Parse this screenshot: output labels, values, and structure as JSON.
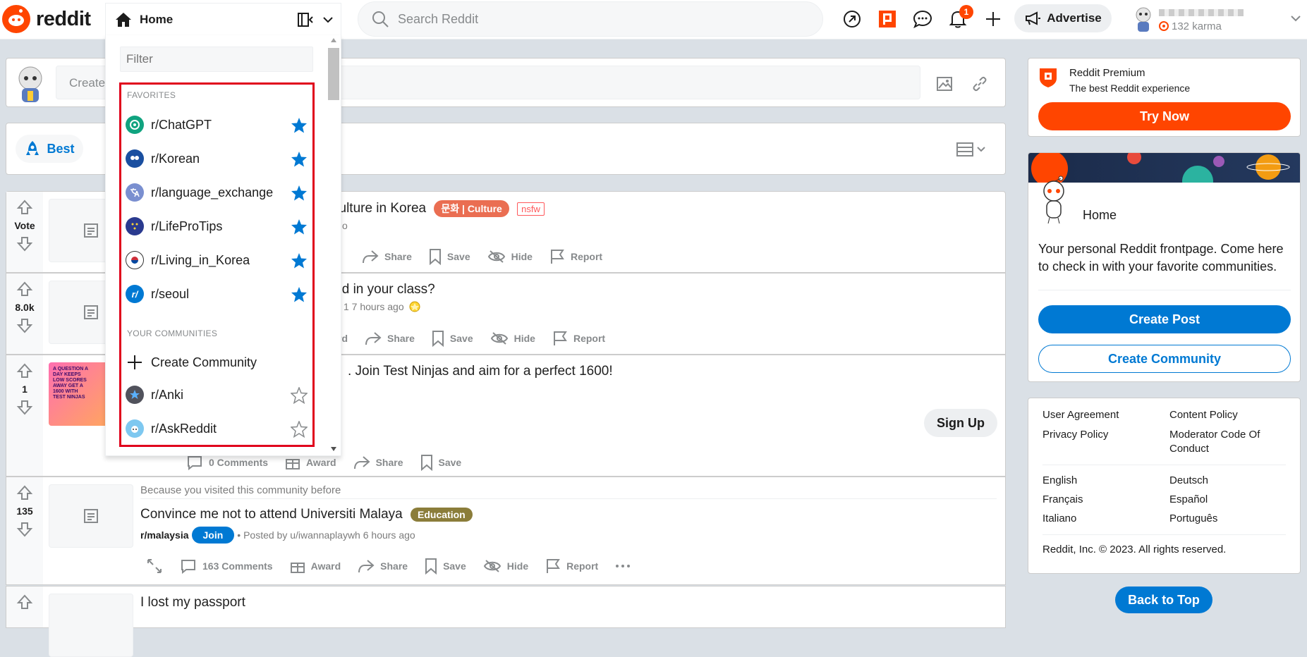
{
  "header": {
    "brand": "reddit",
    "feed_label": "Home",
    "search_placeholder": "Search Reddit",
    "notification_count": "1",
    "advertise_label": "Advertise",
    "karma": "132 karma"
  },
  "create_post": {
    "placeholder": "Create Post"
  },
  "sort": {
    "best_label": "Best"
  },
  "dropdown": {
    "filter_placeholder": "Filter",
    "favorites_heading": "FAVORITES",
    "favorites": [
      {
        "name": "r/ChatGPT",
        "color": "#10a37f"
      },
      {
        "name": "r/Korean",
        "color": "#1a4fa0"
      },
      {
        "name": "r/language_exchange",
        "color": "#7a8fd0"
      },
      {
        "name": "r/LifeProTips",
        "color": "#2a3a8f"
      },
      {
        "name": "r/Living_in_Korea",
        "color": "#ffffff"
      },
      {
        "name": "r/seoul",
        "color": "#0079d3"
      }
    ],
    "communities_heading": "YOUR COMMUNITIES",
    "create_community": "Create Community",
    "communities": [
      {
        "name": "r/Anki",
        "color": "#51525c"
      },
      {
        "name": "r/AskReddit",
        "color": "#7ec8f0"
      }
    ]
  },
  "posts": [
    {
      "votes": "Vote",
      "title_fragment": "culture in Korea",
      "flair": "문화 | Culture",
      "flair_color": "#ea6e52",
      "nsfw": "nsfw",
      "meta_fragment": "o",
      "actions": [
        "Share",
        "Save",
        "Hide",
        "Report"
      ]
    },
    {
      "votes": "8.0k",
      "title_fragment": "kid in your class?",
      "meta_fragment": "1 7 hours ago",
      "actions": [
        "rd",
        "Share",
        "Save",
        "Hide",
        "Report"
      ]
    },
    {
      "votes": "1",
      "title_fragment": ". Join Test Ninjas and aim for a perfect 1600!",
      "signup": "Sign Up",
      "ad_text": "A QUESTION A DAY KEEPS LOW SCORES AWAY GET A 1600 WITH TEST NINJAS",
      "actions": [
        "0 Comments",
        "Award",
        "Share",
        "Save"
      ]
    },
    {
      "votes": "135",
      "reason": "Because you visited this community before",
      "title": "Convince me not to attend Universiti Malaya",
      "flair": "Education",
      "flair_color": "#8b7d3a",
      "subreddit": "r/malaysia",
      "join": "Join",
      "meta": "• Posted by u/iwannaplaywh 6 hours ago",
      "actions": [
        "163 Comments",
        "Award",
        "Share",
        "Save",
        "Hide",
        "Report"
      ]
    },
    {
      "title": "I lost my passport"
    }
  ],
  "premium": {
    "title": "Reddit Premium",
    "subtitle": "The best Reddit experience",
    "button": "Try Now"
  },
  "home_card": {
    "title": "Home",
    "description": "Your personal Reddit frontpage. Come here to check in with your favorite communities.",
    "create_post": "Create Post",
    "create_community": "Create Community"
  },
  "footer_links": {
    "col1": [
      "User Agreement",
      "Privacy Policy"
    ],
    "col2": [
      "Content Policy",
      "Moderator Code Of Conduct"
    ],
    "languages": [
      "English",
      "Deutsch",
      "Français",
      "Español",
      "Italiano",
      "Português"
    ],
    "copyright": "Reddit, Inc. © 2023. All rights reserved."
  },
  "back_to_top": "Back to Top",
  "colors": {
    "accent": "#ff4500",
    "blue": "#0079d3",
    "highlight": "#e0001c"
  }
}
